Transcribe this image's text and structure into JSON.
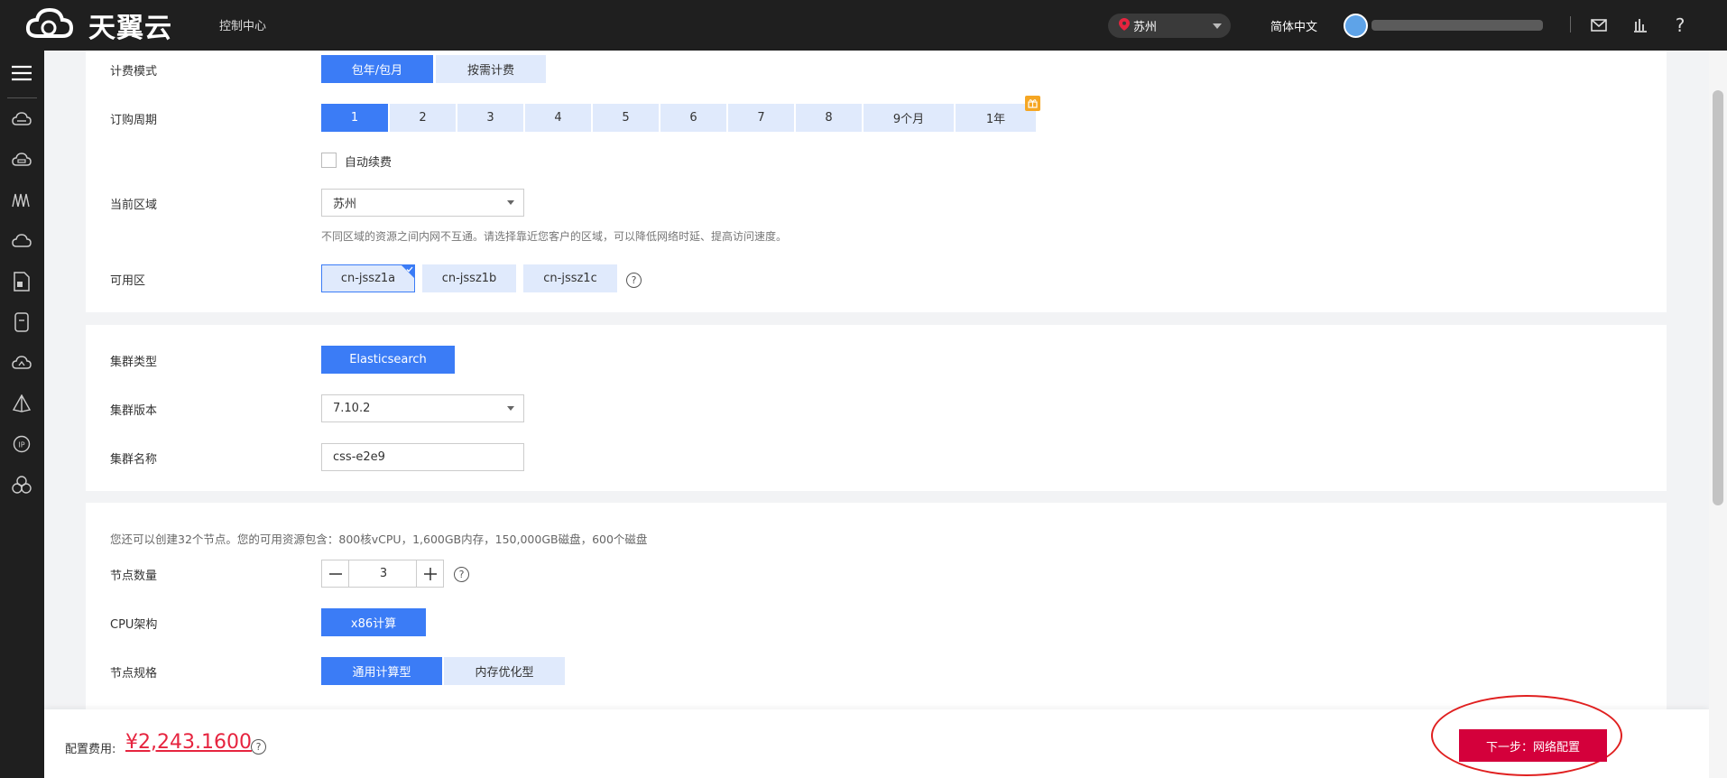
{
  "topbar": {
    "logo_text": "天翼云",
    "console_link": "控制中心",
    "region": "苏州",
    "language": "简体中文"
  },
  "sidebar": {
    "icons": [
      "menu-icon",
      "cloud-server-icon",
      "disk-icon",
      "network-icon",
      "cloud-icon",
      "document-icon",
      "storage-icon",
      "cloud-sync-icon",
      "pyramid-icon",
      "ip-icon",
      "cluster-icon"
    ]
  },
  "billing": {
    "mode_label": "计费模式",
    "modes": [
      "包年/包月",
      "按需计费"
    ],
    "period_label": "订购周期",
    "periods": [
      "1",
      "2",
      "3",
      "4",
      "5",
      "6",
      "7",
      "8",
      "9个月",
      "1年"
    ],
    "auto_renew_label": "自动续费",
    "region_label": "当前区域",
    "region_value": "苏州",
    "region_hint": "不同区域的资源之间内网不互通。请选择靠近您客户的区域，可以降低网络时延、提高访问速度。",
    "az_label": "可用区",
    "azs": [
      "cn-jssz1a",
      "cn-jssz1b",
      "cn-jssz1c"
    ]
  },
  "cluster": {
    "type_label": "集群类型",
    "type_value": "Elasticsearch",
    "version_label": "集群版本",
    "version_value": "7.10.2",
    "name_label": "集群名称",
    "name_value": "css-e2e9"
  },
  "nodes": {
    "quota_text": "您还可以创建32个节点。您的可用资源包含：800核vCPU，1,600GB内存，150,000GB磁盘，600个磁盘",
    "count_label": "节点数量",
    "count_value": "3",
    "cpu_label": "CPU架构",
    "cpu_value": "x86计算",
    "spec_label": "节点规格",
    "specs": [
      "通用计算型",
      "内存优化型"
    ]
  },
  "footer": {
    "fee_label": "配置费用:",
    "fee_value": "¥2,243.1600",
    "next_button": "下一步：网络配置"
  },
  "colors": {
    "primary": "#3b7cf6",
    "primary_light": "#e0eafc",
    "danger": "#d4003b",
    "price": "#e6243f"
  }
}
